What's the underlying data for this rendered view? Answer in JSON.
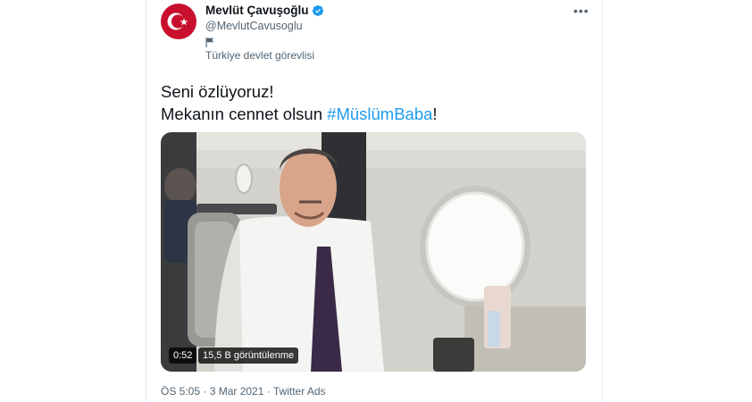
{
  "author": {
    "name": "Mevlüt Çavuşoğlu",
    "handle": "@MevlutCavusoglu",
    "label": "Türkiye devlet görevlisi",
    "verified": true,
    "avatar_icon": "turkey-flag-crescent-star"
  },
  "tweet": {
    "line1": "Seni özlüyoruz!",
    "line2_prefix": "Mekanın cennet olsun ",
    "hashtag": "#MüslümBaba",
    "line2_suffix": "!"
  },
  "video": {
    "duration": "0:52",
    "views": "15,5 B görüntülenme"
  },
  "meta": {
    "time": "ÖS 5:05",
    "sep1": " · ",
    "date": "3 Mar 2021",
    "sep2": " · ",
    "source": "Twitter Ads"
  },
  "icons": {
    "more": "more-dots-icon",
    "verified": "verified-badge-icon",
    "label": "flag-icon"
  },
  "colors": {
    "accent": "#1d9bf0",
    "text": "#0f1419",
    "secondary": "#536471",
    "avatar_red": "#c8102e"
  }
}
